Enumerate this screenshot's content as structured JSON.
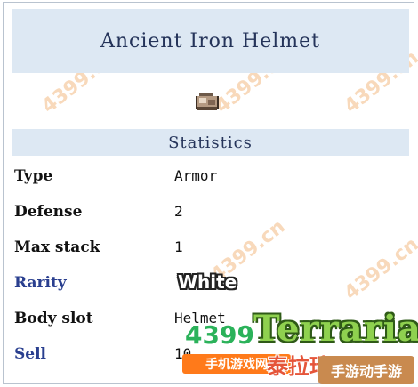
{
  "item": {
    "title": "Ancient Iron Helmet",
    "icon": "helmet-icon"
  },
  "stats": {
    "header": "Statistics",
    "rows": [
      {
        "label": "Type",
        "value": "Armor"
      },
      {
        "label": "Defense",
        "value": "2"
      },
      {
        "label": "Max stack",
        "value": "1"
      },
      {
        "label": "Rarity",
        "value": "White"
      },
      {
        "label": "Body slot",
        "value": "Helmet"
      },
      {
        "label": "Sell",
        "value": "10"
      }
    ]
  },
  "watermarks": {
    "site": "4399.cn",
    "logo_num": "4399",
    "logo_cn": "手机游戏网",
    "logo_game": "Terraria",
    "logo_game_cn": "泰拉瑞亚",
    "badge": "手游动手游"
  },
  "colors": {
    "header_bg": "#dde8f3",
    "header_text": "#25345a",
    "link_text": "#2a3f8f"
  }
}
